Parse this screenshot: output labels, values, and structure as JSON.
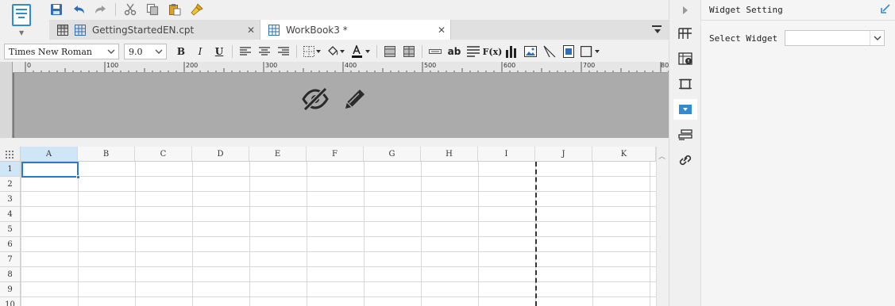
{
  "tabs": [
    {
      "label": "GettingStartedEN.cpt",
      "active": false
    },
    {
      "label": "WorkBook3 *",
      "active": true
    }
  ],
  "quick_toolbar": [
    "save-icon",
    "undo-icon",
    "redo-icon",
    "cut-icon",
    "copy-icon",
    "paste-icon",
    "format-painter-icon"
  ],
  "format": {
    "font_family": "Times New Roman",
    "font_size": "9.0",
    "bold": "B",
    "italic": "I",
    "underline": "U",
    "text_ab": "ab",
    "formula": "F(x)"
  },
  "ruler": {
    "labels": [
      "0",
      "100",
      "200",
      "300",
      "400",
      "500",
      "600",
      "700",
      "80"
    ]
  },
  "grid": {
    "columns": [
      "A",
      "B",
      "C",
      "D",
      "E",
      "F",
      "G",
      "H",
      "I",
      "J",
      "K"
    ],
    "rows": [
      "1",
      "2",
      "3",
      "4",
      "5",
      "6",
      "7",
      "8",
      "9",
      "10"
    ],
    "selected_cell": "A1"
  },
  "right_panel": {
    "title": "Widget Setting",
    "select_widget_label": "Select Widget",
    "select_widget_value": ""
  },
  "colors": {
    "accent": "#2b78d0",
    "selected_header": "#cfe6f7",
    "header_area": "#ababab",
    "font_color": "#d32f2f"
  }
}
